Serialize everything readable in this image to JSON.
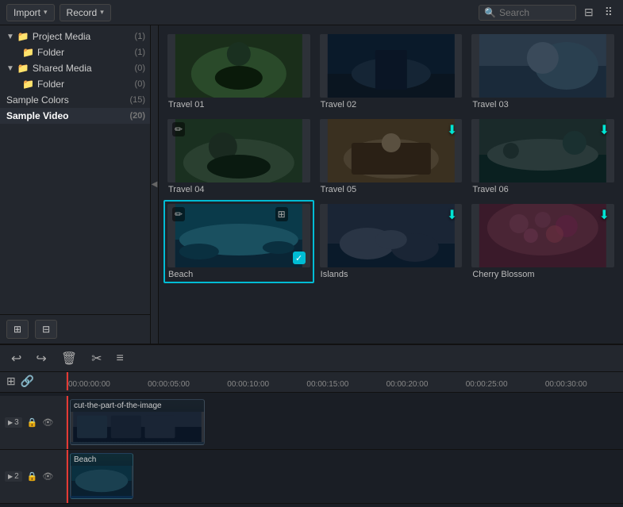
{
  "toolbar": {
    "import_label": "Import",
    "record_label": "Record",
    "search_placeholder": "Search",
    "filter_icon": "⊟",
    "grid_icon": "⠿"
  },
  "sidebar": {
    "project_media_label": "Project Media",
    "project_media_count": "(1)",
    "project_folder_label": "Folder",
    "project_folder_count": "(1)",
    "shared_media_label": "Shared Media",
    "shared_media_count": "(0)",
    "shared_folder_label": "Folder",
    "shared_folder_count": "(0)",
    "sample_colors_label": "Sample Colors",
    "sample_colors_count": "(15)",
    "sample_video_label": "Sample Video",
    "sample_video_count": "(20)",
    "add_folder_icon": "⊞",
    "remove_icon": "⊟"
  },
  "media_grid": {
    "items": [
      {
        "id": "travel01",
        "label": "Travel 01",
        "type": "video",
        "selected": false,
        "has_download": false,
        "has_edit": false
      },
      {
        "id": "travel02",
        "label": "Travel 02",
        "type": "video",
        "selected": false,
        "has_download": false,
        "has_edit": false
      },
      {
        "id": "travel03",
        "label": "Travel 03",
        "type": "video",
        "selected": false,
        "has_download": false,
        "has_edit": false
      },
      {
        "id": "travel04",
        "label": "Travel 04",
        "type": "video",
        "selected": false,
        "has_download": false,
        "has_edit": true
      },
      {
        "id": "travel05",
        "label": "Travel 05",
        "type": "video",
        "selected": false,
        "has_download": true,
        "has_edit": false
      },
      {
        "id": "travel06",
        "label": "Travel 06",
        "type": "video",
        "selected": false,
        "has_download": true,
        "has_edit": false
      },
      {
        "id": "beach",
        "label": "Beach",
        "type": "video",
        "selected": true,
        "has_download": false,
        "has_edit": true
      },
      {
        "id": "islands",
        "label": "Islands",
        "type": "video",
        "selected": false,
        "has_download": true,
        "has_edit": false
      },
      {
        "id": "cherry_blossom",
        "label": "Cherry Blossom",
        "type": "video",
        "selected": false,
        "has_download": true,
        "has_edit": false
      }
    ]
  },
  "edit_toolbar": {
    "undo_icon": "↩",
    "redo_icon": "↪",
    "delete_icon": "🗑",
    "cut_icon": "✂",
    "settings_icon": "≡"
  },
  "timeline": {
    "markers": [
      "00:00:00:00",
      "00:00:05:00",
      "00:00:10:00",
      "00:00:15:00",
      "00:00:20:00",
      "00:00:25:00",
      "00:00:30:00"
    ],
    "tracks": [
      {
        "num": "3",
        "icon": "▶",
        "clips": [
          {
            "label": "cut-the-part-of-the-image",
            "color": "clip-video1"
          }
        ]
      },
      {
        "num": "2",
        "icon": "▶",
        "clips": [
          {
            "label": "Beach",
            "color": "clip-video2"
          }
        ]
      }
    ]
  }
}
